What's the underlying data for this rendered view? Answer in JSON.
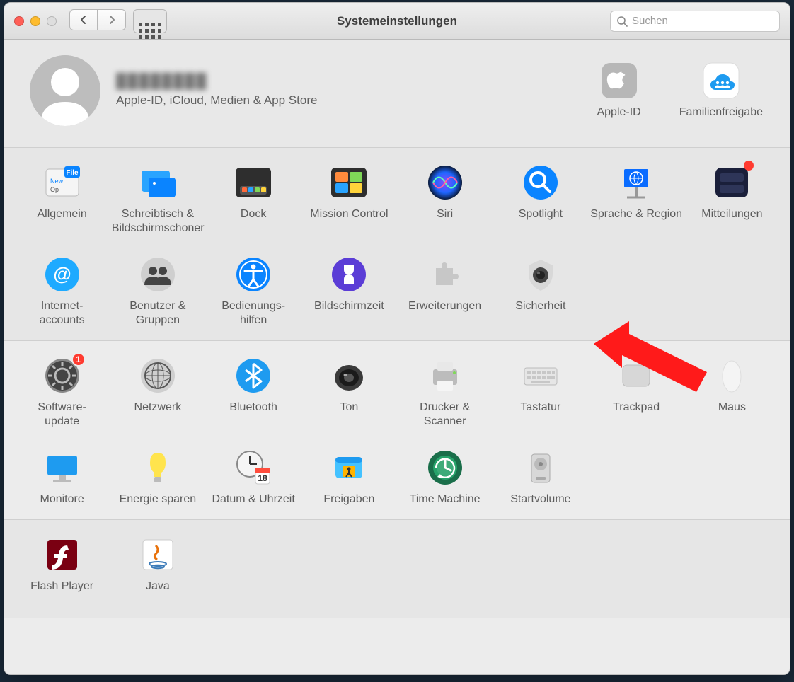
{
  "window": {
    "title": "Systemeinstellungen"
  },
  "search": {
    "placeholder": "Suchen"
  },
  "account": {
    "name_redacted": "████████",
    "subtitle": "Apple-ID, iCloud, Medien & App Store"
  },
  "account_items": [
    {
      "id": "apple-id",
      "label": "Apple-ID"
    },
    {
      "id": "family",
      "label": "Familienfreigabe"
    }
  ],
  "sections": [
    {
      "id": "row1",
      "items": [
        {
          "id": "general",
          "label": "Allgemein"
        },
        {
          "id": "desktop",
          "label": "Schreibtisch & Bildschirmschoner"
        },
        {
          "id": "dock",
          "label": "Dock"
        },
        {
          "id": "mission",
          "label": "Mission Control"
        },
        {
          "id": "siri",
          "label": "Siri"
        },
        {
          "id": "spotlight",
          "label": "Spotlight"
        },
        {
          "id": "language",
          "label": "Sprache & Region"
        },
        {
          "id": "notif",
          "label": "Mitteilungen",
          "dot": true
        }
      ]
    },
    {
      "id": "row2",
      "items": [
        {
          "id": "internet",
          "label": "Internet-\naccounts"
        },
        {
          "id": "users",
          "label": "Benutzer & Gruppen"
        },
        {
          "id": "access",
          "label": "Bedienungs-\nhilfen"
        },
        {
          "id": "screentime",
          "label": "Bildschirmzeit"
        },
        {
          "id": "extensions",
          "label": "Erweiterungen"
        },
        {
          "id": "security",
          "label": "Sicherheit"
        }
      ]
    },
    {
      "id": "row3",
      "items": [
        {
          "id": "software",
          "label": "Software-\nupdate",
          "badge": "1"
        },
        {
          "id": "network",
          "label": "Netzwerk"
        },
        {
          "id": "bluetooth",
          "label": "Bluetooth"
        },
        {
          "id": "sound",
          "label": "Ton"
        },
        {
          "id": "printers",
          "label": "Drucker & Scanner"
        },
        {
          "id": "keyboard",
          "label": "Tastatur"
        },
        {
          "id": "trackpad",
          "label": "Trackpad"
        },
        {
          "id": "mouse",
          "label": "Maus"
        }
      ]
    },
    {
      "id": "row4",
      "items": [
        {
          "id": "displays",
          "label": "Monitore"
        },
        {
          "id": "energy",
          "label": "Energie sparen"
        },
        {
          "id": "datetime",
          "label": "Datum & Uhrzeit",
          "cal": "18"
        },
        {
          "id": "sharing",
          "label": "Freigaben"
        },
        {
          "id": "tm",
          "label": "Time Machine"
        },
        {
          "id": "startup",
          "label": "Startvolume"
        }
      ]
    },
    {
      "id": "row5",
      "items": [
        {
          "id": "flash",
          "label": "Flash Player"
        },
        {
          "id": "java",
          "label": "Java"
        }
      ]
    }
  ],
  "annotation": {
    "arrow_points_to": "security"
  }
}
